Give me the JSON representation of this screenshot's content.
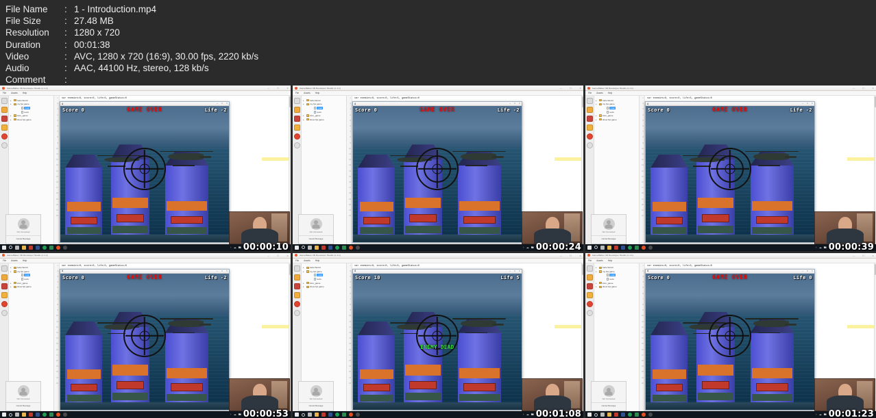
{
  "metadata": {
    "rows": [
      {
        "label": "File Name",
        "value": "1 - Introduction.mp4"
      },
      {
        "label": "File Size",
        "value": "27.48 MB"
      },
      {
        "label": "Resolution",
        "value": "1280 x 720"
      },
      {
        "label": "Duration",
        "value": "00:01:38"
      },
      {
        "label": "Video",
        "value": "AVC, 1280 x 720 (16:9), 30.00 fps, 2220 kb/s"
      },
      {
        "label": "Audio",
        "value": "AAC, 44100 Hz, stereo, 128 kb/s"
      },
      {
        "label": "Comment",
        "value": ""
      }
    ],
    "colon": ":"
  },
  "ide": {
    "title": "GameMaker 3D Developer Studio (1.1.1)",
    "menu": [
      "File",
      "Assets",
      "Help"
    ],
    "code_line": "var enemies=0, score=0, life=5, gameStatus=0",
    "line_numbers": [
      "1",
      "2",
      "3",
      "4",
      "5",
      "6",
      "7",
      "8",
      "9",
      "10",
      "11",
      "12",
      "13",
      "14",
      "15",
      "16",
      "17",
      "18",
      "19",
      "20",
      "21",
      "22"
    ],
    "tree": [
      {
        "label": "hello World",
        "type": "folder",
        "level": 0,
        "selected": false
      },
      {
        "label": "my fps game",
        "type": "folder",
        "level": 0,
        "selected": false
      },
      {
        "label": "main",
        "type": "file",
        "level": 2,
        "selected": true
      },
      {
        "label": "texts",
        "type": "file",
        "level": 2,
        "selected": false
      },
      {
        "label": "intro_game",
        "type": "folder",
        "level": 0,
        "selected": false
      },
      {
        "label": "show fps game",
        "type": "folder",
        "level": 0,
        "selected": false
      }
    ],
    "window_controls": [
      "–",
      "□",
      "×"
    ]
  },
  "game_window": {
    "title": "4",
    "controls": [
      "–",
      "□",
      "×"
    ]
  },
  "message_panel": {
    "status": "Not Connected",
    "action": "Cancel Message"
  },
  "taskbar": {
    "icons": [
      "start-icon",
      "search-icon",
      "task-view-icon",
      "file-explorer-icon",
      "app-red-icon",
      "app-blue-icon",
      "app-green-icon",
      "app-teal-icon",
      "app-orange-icon",
      "app-gray-icon"
    ],
    "tray": [
      "↑",
      "☁",
      "🖿"
    ]
  },
  "colors": {
    "background": "#2b2b2b",
    "text": "#ececec",
    "game_over": "#e01010",
    "enemy_dead": "#39e13b",
    "hud_text": "#ffffff",
    "tower_blue": "#4b4fd1",
    "tower_orange": "#d9732c",
    "highlight_yellow": "#fbf2a0"
  },
  "thumbnails": [
    {
      "index": 1,
      "timestamp": "00:00:10",
      "score_label": "Score 0",
      "life_label": "Life -2",
      "banner": "GAME OVER",
      "banner_type": "game-over",
      "enemy_dead": null
    },
    {
      "index": 2,
      "timestamp": "00:00:24",
      "score_label": "Score 0",
      "life_label": "Life -2",
      "banner": "GAME OVER",
      "banner_type": "game-over",
      "enemy_dead": null
    },
    {
      "index": 3,
      "timestamp": "00:00:39",
      "score_label": "Score 0",
      "life_label": "Life -2",
      "banner": "GAME OVER",
      "banner_type": "game-over",
      "enemy_dead": null
    },
    {
      "index": 4,
      "timestamp": "00:00:53",
      "score_label": "Score 0",
      "life_label": "Life -2",
      "banner": "GAME OVER",
      "banner_type": "game-over",
      "enemy_dead": null
    },
    {
      "index": 5,
      "timestamp": "00:01:08",
      "score_label": "Score 10",
      "life_label": "Life 5",
      "banner": null,
      "banner_type": "none",
      "enemy_dead": "ENEMY DEAD"
    },
    {
      "index": 6,
      "timestamp": "00:01:23",
      "score_label": "Score 0",
      "life_label": "Life 0",
      "banner": "GAME OVER",
      "banner_type": "game-over",
      "enemy_dead": null
    }
  ]
}
